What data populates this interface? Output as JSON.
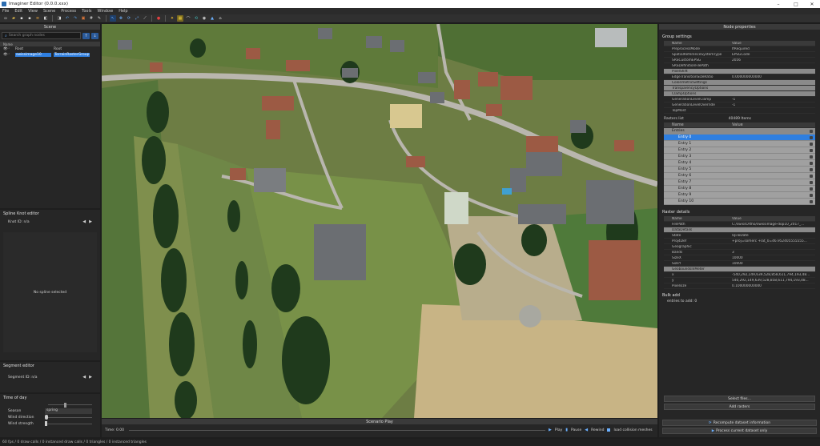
{
  "window": {
    "title": "Imaginer Editor (0.0.0.xxx)"
  },
  "menu": [
    "File",
    "Edit",
    "View",
    "Scene",
    "Process",
    "Tools",
    "Window",
    "Help"
  ],
  "toolbar": {
    "icons": [
      "new-file-icon",
      "open-folder-icon",
      "save-icon",
      "save-as-icon",
      "layers-icon",
      "import-icon",
      "export-icon",
      "undo-icon",
      "redo-icon",
      "crop-icon",
      "grid-icon",
      "pen-icon",
      "select-icon",
      "move-icon",
      "rotate-icon",
      "scale-icon",
      "measure-icon",
      "pin-icon",
      "star-icon",
      "chart-icon",
      "brush-icon",
      "sync-icon",
      "camera-icon",
      "water-icon",
      "terrain-icon"
    ]
  },
  "scene": {
    "title": "Scene",
    "search_placeholder": "Search graph nodes",
    "col_name": "Name",
    "rows": [
      {
        "name": "Root",
        "type": "Root"
      },
      {
        "name": "swissimage10",
        "type": "TerrainRasterGroup"
      }
    ]
  },
  "spline": {
    "title": "Spline Knot editor",
    "knot": "Knot ID: n/a",
    "empty": "No spline selected"
  },
  "segment": {
    "title": "Segment editor",
    "id": "Segment ID: n/a"
  },
  "tod": {
    "title": "Time of day",
    "season_label": "Season",
    "season_value": "spring",
    "wind_dir_label": "Wind direction",
    "wind_str_label": "Wind strength"
  },
  "scenario": {
    "title": "Scenario Play",
    "time": "Time: 0.00",
    "play": "Play",
    "pause": "Pause",
    "rewind": "Rewind",
    "load": "load collision meshes"
  },
  "status": "60 fps / 0 draw calls / 0 instanced draw calls / 0 triangles / 0 instanced triangles",
  "node": {
    "title": "Node properties",
    "group_settings": "Group settings",
    "header_name": "Name",
    "header_value": "Value",
    "props": [
      {
        "k": "PreprocessMode",
        "v": "IfRequired",
        "grp": false
      },
      {
        "k": "SpatialReferenceSystemType",
        "v": "EPSGCode",
        "grp": false
      },
      {
        "k": "SRSCustomEPSG",
        "v": "2056",
        "grp": false
      },
      {
        "k": "SRSDefinitionFilePath",
        "v": "",
        "grp": false
      },
      {
        "k": "PixelShift",
        "v": "",
        "grp": true
      },
      {
        "k": "EdgeTransitionSizeRatio",
        "v": "0.000000000000",
        "grp": false
      },
      {
        "k": "ColorimetricSettings",
        "v": "",
        "grp": true
      },
      {
        "k": "TransparencyOptions",
        "v": "",
        "grp": true
      },
      {
        "k": "ClampOptions",
        "v": "",
        "grp": true
      },
      {
        "k": "GenerationLevelClamp",
        "v": "-1",
        "grp": false
      },
      {
        "k": "GenerationLevelOverride",
        "v": "-1",
        "grp": false
      },
      {
        "k": "TopMost",
        "v": "",
        "grp": false
      }
    ],
    "rasters_label": "Rasters list",
    "rasters_count": "40489 Items",
    "entries_label": "Entries",
    "entries": [
      "Entry 0",
      "Entry 1",
      "Entry 2",
      "Entry 3",
      "Entry 4",
      "Entry 5",
      "Entry 6",
      "Entry 7",
      "Entry 8",
      "Entry 9",
      "Entry 10"
    ],
    "raster_details": "Raster details",
    "details": [
      {
        "k": "FilePath",
        "v": "C:/swissOrtho/swissimage-dop10_2017_...",
        "grp": false
      },
      {
        "k": "DataDetails",
        "v": "",
        "grp": true
      },
      {
        "k": "State",
        "v": "UpToDate",
        "grp": false
      },
      {
        "k": "Proj4Def",
        "v": "+proj=somerc +lat_0=46.952405555555...",
        "grp": false
      },
      {
        "k": "Geographic",
        "v": "",
        "grp": false
      },
      {
        "k": "Bands",
        "v": "3",
        "grp": false
      },
      {
        "k": "SizeX",
        "v": "10000",
        "grp": false
      },
      {
        "k": "SizeY",
        "v": "10000",
        "grp": false
      },
      {
        "k": "GeoboundsInMeter",
        "v": "",
        "grp": true
      },
      {
        "k": "x",
        "v": "-540,292,149,639,528,858,611,794,193,48...",
        "grp": false
      },
      {
        "k": "y",
        "v": "540,292,149,639,528,858,611,794,193,48...",
        "grp": false
      },
      {
        "k": "Pixelsize",
        "v": "0.100000000000",
        "grp": false
      }
    ],
    "bulk_title": "Bulk add",
    "bulk_info": "entries to add: 0",
    "select_files": "Select files...",
    "add_rasters": "Add rasters",
    "recompute": "Recompute dataset information",
    "process": "Process current dataset only"
  }
}
